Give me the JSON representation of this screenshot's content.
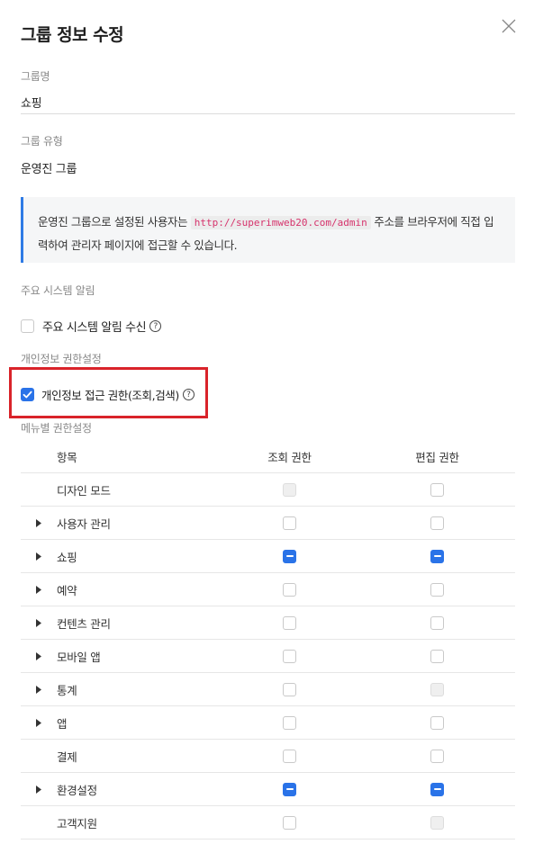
{
  "dialog": {
    "title": "그룹 정보 수정",
    "close_icon": "close-icon"
  },
  "group_name": {
    "label": "그룹명",
    "value": "쇼핑"
  },
  "group_type": {
    "label": "그룹 유형",
    "value": "운영진 그룹"
  },
  "info": {
    "text_before": "운영진 그룹으로 설정된 사용자는",
    "url": "http://superimweb20.com/admin",
    "text_after": "주소를 브라우저에 직접 입력하여 관리자 페이지에 접근할 수 있습니다.",
    "accent_color": "#2f7be5"
  },
  "system_alert": {
    "section_label": "주요 시스템 알림",
    "checkbox_label": "주요 시스템 알림 수신",
    "checked": false
  },
  "privacy": {
    "section_label": "개인정보 권한설정",
    "checkbox_label": "개인정보 접근 권한(조회,검색)",
    "checked": true,
    "highlight_color": "#d9232a"
  },
  "menu_permissions": {
    "section_label": "메뉴별 권한설정",
    "headers": {
      "item": "항목",
      "view": "조회 권한",
      "edit": "편집 권한"
    },
    "rows": [
      {
        "label": "디자인 모드",
        "expandable": false,
        "view": "disabled",
        "edit": "unchecked"
      },
      {
        "label": "사용자 관리",
        "expandable": true,
        "view": "unchecked",
        "edit": "unchecked"
      },
      {
        "label": "쇼핑",
        "expandable": true,
        "view": "indeterminate",
        "edit": "indeterminate"
      },
      {
        "label": "예약",
        "expandable": true,
        "view": "unchecked",
        "edit": "unchecked"
      },
      {
        "label": "컨텐츠 관리",
        "expandable": true,
        "view": "unchecked",
        "edit": "unchecked"
      },
      {
        "label": "모바일 앱",
        "expandable": true,
        "view": "unchecked",
        "edit": "unchecked"
      },
      {
        "label": "통계",
        "expandable": true,
        "view": "unchecked",
        "edit": "disabled"
      },
      {
        "label": "앱",
        "expandable": true,
        "view": "unchecked",
        "edit": "unchecked"
      },
      {
        "label": "결제",
        "expandable": false,
        "view": "unchecked",
        "edit": "unchecked"
      },
      {
        "label": "환경설정",
        "expandable": true,
        "view": "indeterminate",
        "edit": "indeterminate"
      },
      {
        "label": "고객지원",
        "expandable": false,
        "view": "unchecked",
        "edit": "disabled"
      }
    ]
  },
  "colors": {
    "checkbox_active": "#2a73e8"
  }
}
